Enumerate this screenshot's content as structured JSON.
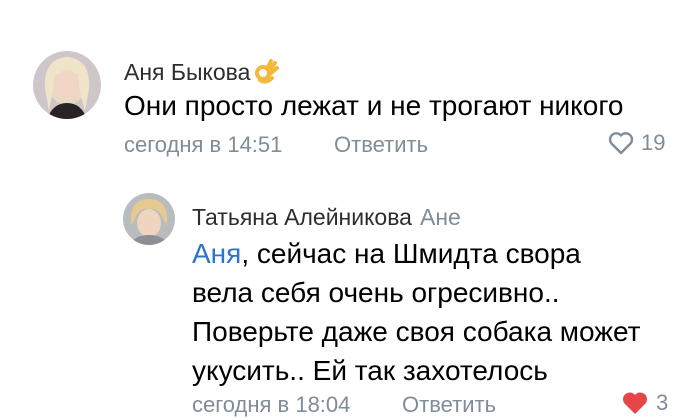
{
  "comments": [
    {
      "author": "Аня Быкова",
      "author_emoji_icon": "ok-hand-emoji-icon",
      "text": "Они просто лежат и не трогают никого",
      "time": "сегодня в 14:51",
      "reply_label": "Ответить",
      "likes": "19",
      "liked": false
    },
    {
      "author": "Татьяна Алейникова",
      "reply_to": "Ане",
      "mention": "Аня",
      "text_line1": ", сейчас на Шмидта свора",
      "text_line2": "вела себя очень огресивно..",
      "text_line3": "Поверьте даже своя собака может",
      "text_line4": "укусить.. Ей так захотелось",
      "time": "сегодня в 18:04",
      "reply_label": "Ответить",
      "likes": "3",
      "liked": true
    }
  ],
  "colors": {
    "secondary_text": "#818c99",
    "link": "#2a74c9",
    "like_active": "#e64646"
  }
}
